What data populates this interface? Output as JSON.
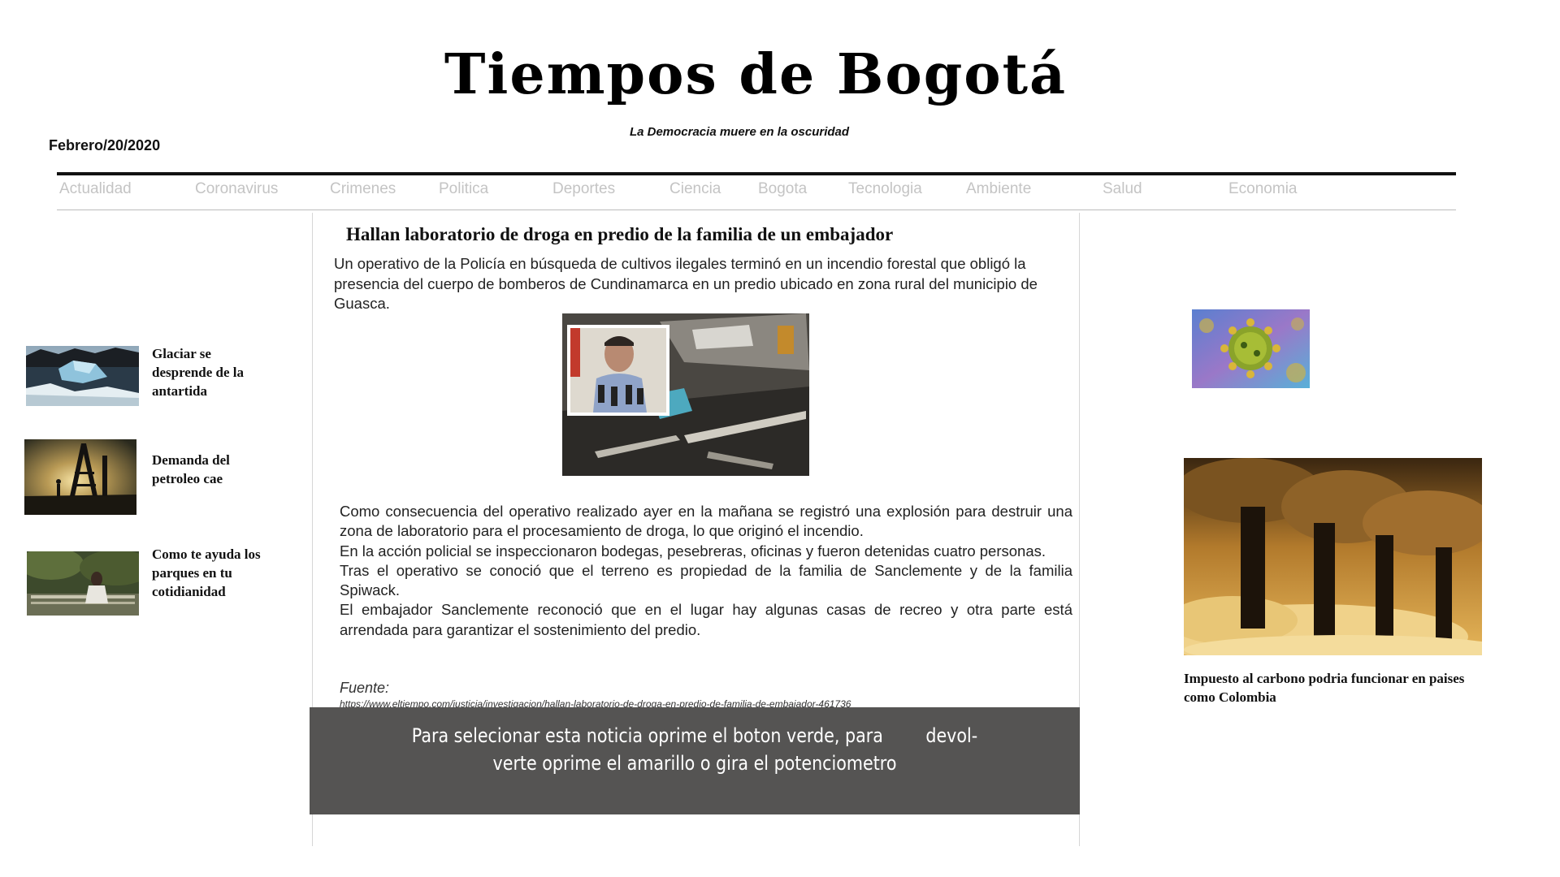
{
  "masthead": {
    "title": "Tiempos  de  Bogotá",
    "motto": "La Democracia muere en la oscuridad",
    "date": "Febrero/20/2020"
  },
  "nav": {
    "items": [
      "Actualidad",
      "Coronavirus",
      "Crimenes",
      "Politica",
      "Deportes",
      "Ciencia",
      "Bogota",
      "Tecnologia",
      "Ambiente",
      "Salud",
      "Economia"
    ]
  },
  "left_rail": {
    "items": [
      {
        "title": "Glaciar se desprende de la antartida",
        "icon": "glacier-photo"
      },
      {
        "title": "Demanda del petroleo cae",
        "icon": "oil-derrick-photo"
      },
      {
        "title": "Como te ayuda los parques en tu cotidianidad",
        "icon": "park-bench-photo"
      }
    ]
  },
  "article": {
    "headline": "Hallan laboratorio  de droga en predio de la familia de un embajador",
    "lead": "Un operativo de la Policía en búsqueda de cultivos ilegales terminó en un incendio forestal que obligó la presencia del cuerpo de bomberos de Cundinamarca en un predio ubicado en zona rural del municipio de Guasca.",
    "paragraphs": [
      "Como consecuencia del operativo realizado ayer en la mañana se registró una explosión para destruir una zona de laboratorio para el procesamiento de droga, lo que originó el incendio.",
      "En la acción policial se inspeccionaron bodegas, pesebreras, oficinas y fueron detenidas cuatro personas.",
      "Tras el operativo se conoció que el terreno es propiedad de la familia de Sanclemente y de la familia Spiwack.",
      "El embajador Sanclemente reconoció que en el  lugar hay algunas casas de recreo y otra parte está arrendada para garantizar el sostenimiento del predio."
    ],
    "source_label": "Fuente:",
    "source_url": "https://www.eltiempo.com/justicia/investigacion/hallan-laboratorio-de-droga-en-predio-de-familia-de-embajador-461736"
  },
  "overlay": {
    "line1": "Para selecionar esta noticia oprime el boton verde, para        devol-",
    "line2": "verte oprime el amarillo o gira el potenciometro"
  },
  "right_rail": {
    "caption": "Impuesto al carbono podria funcionar en paises como Colombia",
    "icons": [
      "coronavirus-photo",
      "smokestacks-photo"
    ]
  },
  "colors": {
    "nav_text": "#c4c4c4",
    "overlay_bg": "#555453",
    "rule": "#111111"
  }
}
